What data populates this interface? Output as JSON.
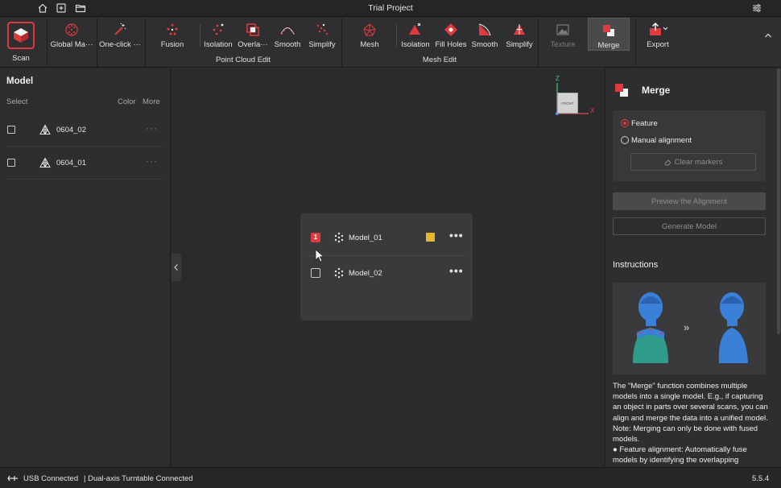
{
  "window": {
    "title": "Trial Project",
    "version": "5.5.4"
  },
  "toolbar": {
    "scan": "Scan",
    "global_markers": "Global Ma···",
    "one_click": "One-click ···",
    "point_cloud_tools": [
      "Fusion",
      "Isolation",
      "Overla···",
      "Smooth",
      "Simplify"
    ],
    "point_cloud_group": "Point Cloud Edit",
    "mesh_tools": [
      "Mesh",
      "Isolation",
      "Fill Holes",
      "Smooth",
      "Simplify"
    ],
    "mesh_group": "Mesh Edit",
    "texture": "Texture",
    "merge": "Merge",
    "export": "Export"
  },
  "left_panel": {
    "title": "Model",
    "col_select": "Select",
    "col_color": "Color",
    "col_more": "More",
    "models": [
      {
        "name": "0604_02",
        "more": "···"
      },
      {
        "name": "0604_01",
        "more": "···"
      }
    ]
  },
  "viewport": {
    "axis_z": "Z",
    "axis_x": "X",
    "cube_label": "FRONT",
    "merge_list": [
      {
        "badge": "1",
        "name": "Model_01",
        "swatch": "#e8b82c",
        "more": "•••"
      },
      {
        "badge": "",
        "name": "Model_02",
        "more": "•••"
      }
    ]
  },
  "right_panel": {
    "title": "Merge",
    "option_feature": "Feature",
    "option_manual": "Manual alignment",
    "clear_markers": "Clear markers",
    "preview": "Preview the Alignment",
    "generate": "Generate Model",
    "instructions_title": "Instructions",
    "illustration_arrow": "»",
    "instructions_p1": "The \"Merge\" function combines multiple models into a single model. E.g., if capturing an object in parts over several scans, you can align and merge the data into a unified model. Note: Merging can only be done with fused models.",
    "instructions_p2": "● Feature alignment: Automatically fuse models by identifying the overlapping"
  },
  "status": {
    "usb": "USB Connected",
    "turntable": "| Dual-axis Turntable Connected"
  },
  "colors": {
    "accent": "#e03a3e",
    "swatch": "#e8b82c",
    "panel": "#2e2e30"
  }
}
